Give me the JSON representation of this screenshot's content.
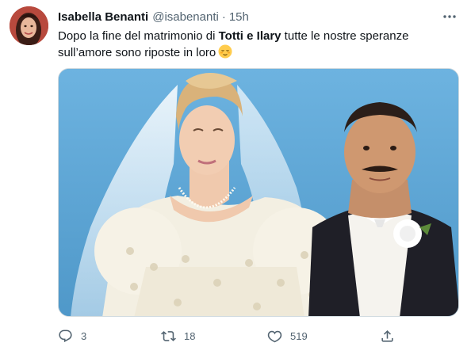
{
  "author": {
    "name": "Isabella Benanti",
    "handle": "@isabenanti",
    "separator": "·",
    "time": "15h"
  },
  "tweet": {
    "text_before": "Dopo la fine del matrimonio di ",
    "text_bold": "Totti e Ilary",
    "text_after": " tutte le nostre speranze sull’amore sono riposte in loro",
    "emoji": "relieved-face-emoji"
  },
  "actions": {
    "reply_count": "3",
    "retweet_count": "18",
    "like_count": "519"
  },
  "icons": [
    "more-icon",
    "reply-icon",
    "retweet-icon",
    "like-icon",
    "share-icon"
  ],
  "colors": {
    "text": "#0f1419",
    "muted": "#536471",
    "photo_bg": "#5aa4d3"
  }
}
